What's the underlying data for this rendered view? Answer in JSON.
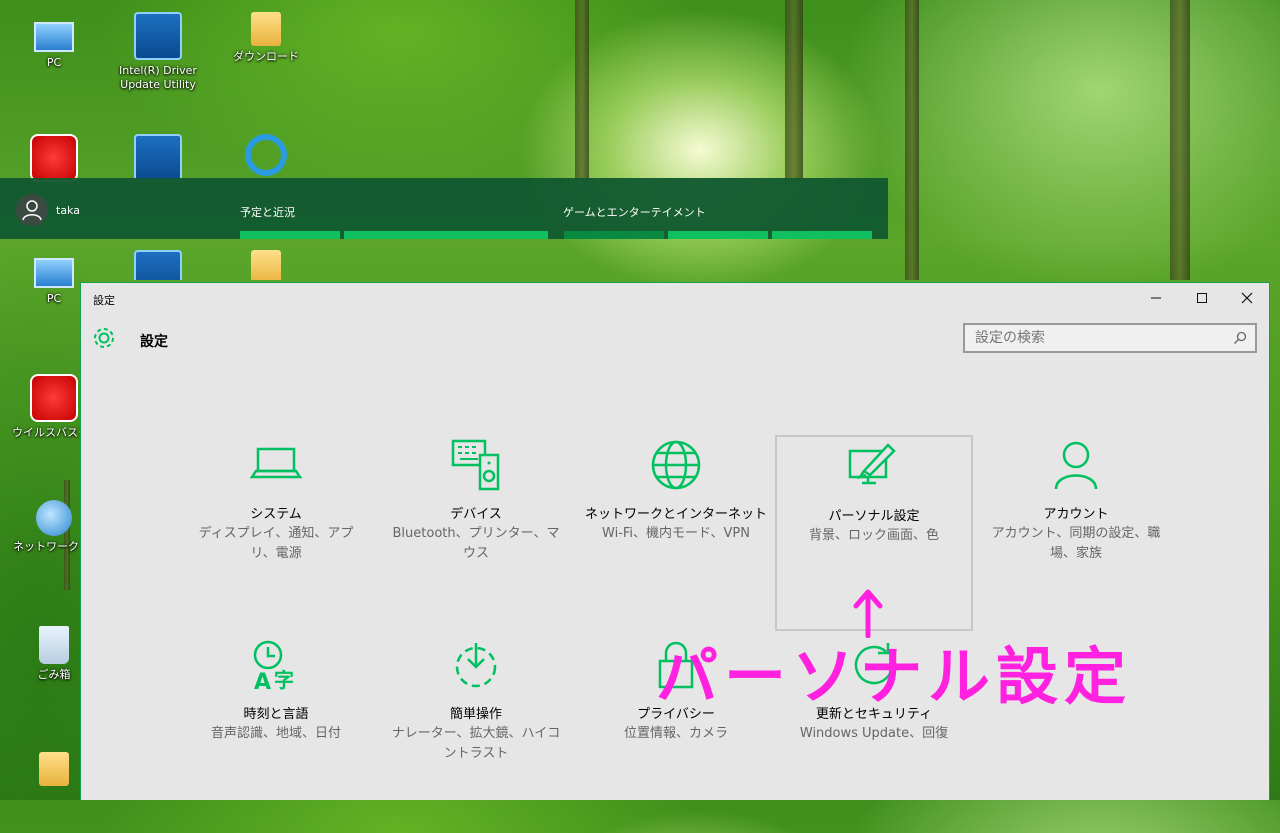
{
  "desktop": {
    "icons": [
      {
        "label": "PC",
        "icon": "computer-icon"
      },
      {
        "label": "Intel(R) Driver Update Utility",
        "icon": "intel-driver-icon"
      },
      {
        "label": "ダウンロード",
        "icon": "folder-download-icon"
      },
      {
        "label": "ウイルスバスター",
        "icon": "virus-buster-icon"
      },
      {
        "label": "ネットワーク",
        "icon": "network-icon"
      },
      {
        "label": "ごみ箱",
        "icon": "recycle-bin-icon"
      }
    ]
  },
  "start_menu": {
    "user": "taka",
    "groups": [
      "予定と近況",
      "ゲームとエンターテイメント"
    ]
  },
  "window": {
    "title": "設定",
    "header_title": "設定",
    "search_placeholder": "設定の検索",
    "controls": {
      "minimize": "─",
      "maximize": "☐",
      "close": "✕"
    },
    "accent": "#00c060"
  },
  "categories": [
    {
      "title": "システム",
      "desc": "ディスプレイ、通知、アプリ、電源",
      "icon": "laptop-icon"
    },
    {
      "title": "デバイス",
      "desc": "Bluetooth、プリンター、マウス",
      "icon": "devices-icon"
    },
    {
      "title": "ネットワークとインターネット",
      "desc": "Wi-Fi、機内モード、VPN",
      "icon": "globe-icon"
    },
    {
      "title": "パーソナル設定",
      "desc": "背景、ロック画面、色",
      "icon": "personalization-icon",
      "selected": true
    },
    {
      "title": "アカウント",
      "desc": "アカウント、同期の設定、職場、家族",
      "icon": "person-icon"
    },
    {
      "title": "時刻と言語",
      "desc": "音声認識、地域、日付",
      "icon": "time-language-icon"
    },
    {
      "title": "簡単操作",
      "desc": "ナレーター、拡大鏡、ハイコントラスト",
      "icon": "ease-of-access-icon"
    },
    {
      "title": "プライバシー",
      "desc": "位置情報、カメラ",
      "icon": "lock-icon"
    },
    {
      "title": "更新とセキュリティ",
      "desc": "Windows Update、回復",
      "icon": "update-icon"
    }
  ],
  "annotation": {
    "text": "パーソナル設定",
    "color": "#ff20e0"
  }
}
